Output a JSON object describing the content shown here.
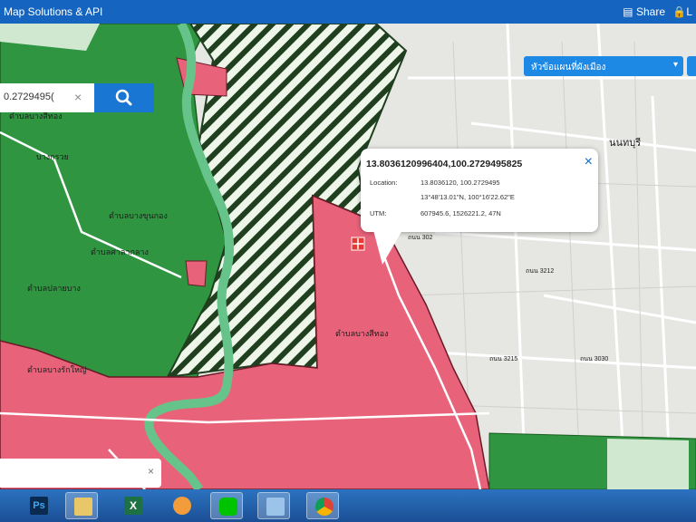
{
  "header": {
    "title": "Map Solutions & API",
    "share_label": "Share",
    "lock_label": "L"
  },
  "layer_button": {
    "label": "หัวข้อแผนที่ผังเมือง"
  },
  "search": {
    "value": "0.2729495(",
    "clear_label": "×"
  },
  "popup": {
    "title": "13.8036120996404,100.2729495825",
    "close_label": "×",
    "rows": [
      {
        "label": "Location:",
        "value": "13.8036120, 100.2729495"
      },
      {
        "label": "",
        "value": "13°48'13.01\"N, 100°16'22.62\"E"
      },
      {
        "label": "UTM:",
        "value": "607945.6, 1526221.2, 47N"
      }
    ]
  },
  "map_labels": {
    "nonthaburi": "นนทบุรี",
    "district_west": "บางกรวย",
    "green_label_1": "ตำบลบางสีทอง",
    "green_label_2": "ตำบลบางขุนกอง",
    "green_label_3": "ตำบลปลายบาง",
    "green_label_4": "ตำบลศาลากลาง",
    "red_label_1": "ตำบลบางสีทอง",
    "red_label_2": "ตำบลบางรักใหญ่",
    "road_1": "ถนน 3212",
    "road_2": "ถนน 302",
    "road_3": "ถนน 3215",
    "road_4": "ถนน 3030"
  },
  "bottom_box": {
    "close_label": "×"
  },
  "colors": {
    "header": "#1565c0",
    "green_zone": "#2f9540",
    "red_zone": "#e8637a",
    "river": "#66c48a",
    "hatch": "#1f3f1f"
  },
  "taskbar": {
    "apps": [
      {
        "icon": "photoshop-icon",
        "active": false
      },
      {
        "icon": "file-explorer-icon",
        "active": true
      },
      {
        "icon": "excel-icon",
        "active": false
      },
      {
        "icon": "media-player-icon",
        "active": false
      },
      {
        "icon": "line-icon",
        "active": false
      },
      {
        "icon": "windows-explorer-icon",
        "active": false
      },
      {
        "icon": "chrome-icon",
        "active": false
      }
    ]
  }
}
